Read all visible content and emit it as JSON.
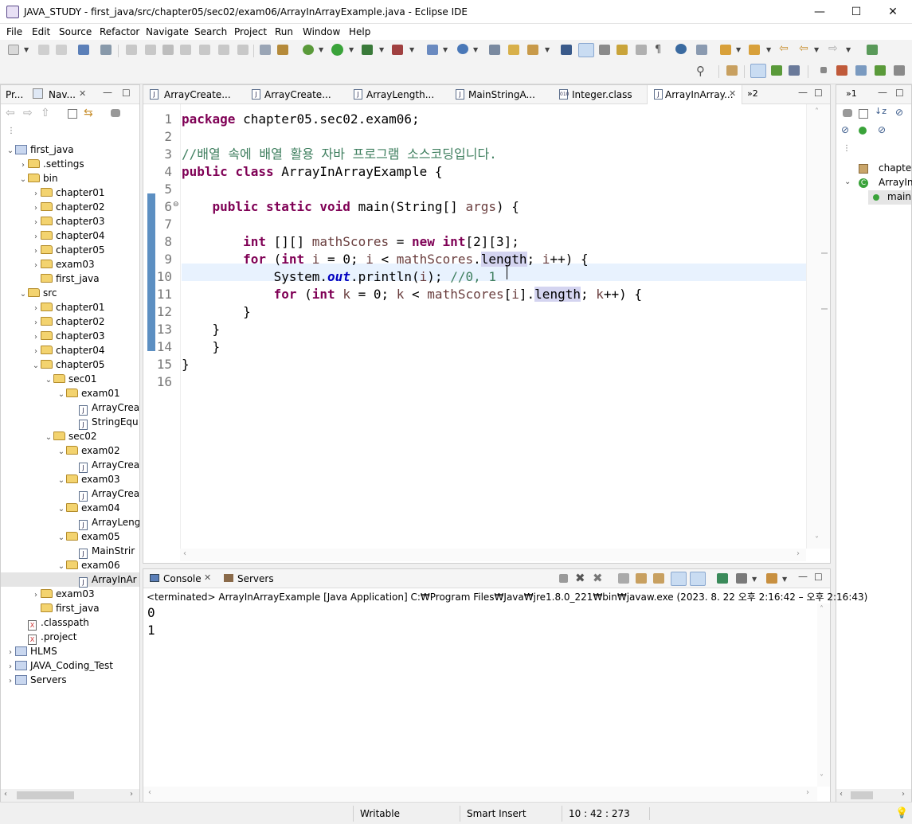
{
  "window": {
    "title": "JAVA_STUDY - first_java/src/chapter05/sec02/exam06/ArrayInArrayExample.java - Eclipse IDE",
    "minimize": "—",
    "maximize": "☐",
    "close": "✕"
  },
  "menu": [
    "File",
    "Edit",
    "Source",
    "Refactor",
    "Navigate",
    "Search",
    "Project",
    "Run",
    "Window",
    "Help"
  ],
  "left_panel": {
    "tabs": [
      "Pr...",
      "Nav..."
    ],
    "tree": [
      {
        "label": "first_java",
        "indent": 0,
        "arrow": "⌄",
        "icon": "project"
      },
      {
        "label": ".settings",
        "indent": 1,
        "arrow": "›",
        "icon": "folder"
      },
      {
        "label": "bin",
        "indent": 1,
        "arrow": "⌄",
        "icon": "folder"
      },
      {
        "label": "chapter01",
        "indent": 2,
        "arrow": "›",
        "icon": "folder"
      },
      {
        "label": "chapter02",
        "indent": 2,
        "arrow": "›",
        "icon": "folder"
      },
      {
        "label": "chapter03",
        "indent": 2,
        "arrow": "›",
        "icon": "folder"
      },
      {
        "label": "chapter04",
        "indent": 2,
        "arrow": "›",
        "icon": "folder"
      },
      {
        "label": "chapter05",
        "indent": 2,
        "arrow": "›",
        "icon": "folder"
      },
      {
        "label": "exam03",
        "indent": 2,
        "arrow": "›",
        "icon": "folder"
      },
      {
        "label": "first_java",
        "indent": 2,
        "arrow": "",
        "icon": "folder"
      },
      {
        "label": "src",
        "indent": 1,
        "arrow": "⌄",
        "icon": "folder"
      },
      {
        "label": "chapter01",
        "indent": 2,
        "arrow": "›",
        "icon": "folder"
      },
      {
        "label": "chapter02",
        "indent": 2,
        "arrow": "›",
        "icon": "folder"
      },
      {
        "label": "chapter03",
        "indent": 2,
        "arrow": "›",
        "icon": "folder"
      },
      {
        "label": "chapter04",
        "indent": 2,
        "arrow": "›",
        "icon": "folder"
      },
      {
        "label": "chapter05",
        "indent": 2,
        "arrow": "⌄",
        "icon": "folder"
      },
      {
        "label": "sec01",
        "indent": 3,
        "arrow": "⌄",
        "icon": "folder"
      },
      {
        "label": "exam01",
        "indent": 4,
        "arrow": "⌄",
        "icon": "folder"
      },
      {
        "label": "ArrayCrea",
        "indent": 5,
        "arrow": "",
        "icon": "java"
      },
      {
        "label": "StringEqu",
        "indent": 5,
        "arrow": "",
        "icon": "java"
      },
      {
        "label": "sec02",
        "indent": 3,
        "arrow": "⌄",
        "icon": "folder"
      },
      {
        "label": "exam02",
        "indent": 4,
        "arrow": "⌄",
        "icon": "folder"
      },
      {
        "label": "ArrayCrea",
        "indent": 5,
        "arrow": "",
        "icon": "java"
      },
      {
        "label": "exam03",
        "indent": 4,
        "arrow": "⌄",
        "icon": "folder"
      },
      {
        "label": "ArrayCrea",
        "indent": 5,
        "arrow": "",
        "icon": "java"
      },
      {
        "label": "exam04",
        "indent": 4,
        "arrow": "⌄",
        "icon": "folder"
      },
      {
        "label": "ArrayLeng",
        "indent": 5,
        "arrow": "",
        "icon": "java"
      },
      {
        "label": "exam05",
        "indent": 4,
        "arrow": "⌄",
        "icon": "folder"
      },
      {
        "label": "MainStrir",
        "indent": 5,
        "arrow": "",
        "icon": "java"
      },
      {
        "label": "exam06",
        "indent": 4,
        "arrow": "⌄",
        "icon": "folder"
      },
      {
        "label": "ArrayInAr",
        "indent": 5,
        "arrow": "",
        "icon": "java",
        "selected": true
      },
      {
        "label": "exam03",
        "indent": 2,
        "arrow": "›",
        "icon": "folder"
      },
      {
        "label": "first_java",
        "indent": 2,
        "arrow": "",
        "icon": "folder"
      },
      {
        "label": ".classpath",
        "indent": 1,
        "arrow": "",
        "icon": "xml"
      },
      {
        "label": ".project",
        "indent": 1,
        "arrow": "",
        "icon": "xml"
      },
      {
        "label": "HLMS",
        "indent": 0,
        "arrow": "›",
        "icon": "project"
      },
      {
        "label": "JAVA_Coding_Test",
        "indent": 0,
        "arrow": "›",
        "icon": "project"
      },
      {
        "label": "Servers",
        "indent": 0,
        "arrow": "›",
        "icon": "project"
      }
    ]
  },
  "editor": {
    "tabs": [
      "ArrayCreate...",
      "ArrayCreate...",
      "ArrayLength...",
      "MainStringA...",
      "Integer.class",
      "ArrayInArray..."
    ],
    "overflow": "»2",
    "lines": [
      {
        "n": "1",
        "html": "<span class='kw'>package</span> chapter05.sec02.exam06;"
      },
      {
        "n": "2",
        "html": ""
      },
      {
        "n": "3",
        "html": "<span class='cm'>//배열 속에 배열 활용 자바 프로그램 소스코딩입니다.</span>"
      },
      {
        "n": "4",
        "html": "<span class='kw'>public</span> <span class='kw'>class</span> ArrayInArrayExample {"
      },
      {
        "n": "5",
        "html": ""
      },
      {
        "n": "6",
        "html": "    <span class='kw'>public</span> <span class='kw'>static</span> <span class='kw'>void</span> main(String[] <span class='vr'>args</span>) {"
      },
      {
        "n": "7",
        "html": ""
      },
      {
        "n": "8",
        "html": "        <span class='kw'>int</span> [][] <span class='vr'>mathScores</span> = <span class='kw'>new</span> <span class='kw'>int</span>[2][3];"
      },
      {
        "n": "9",
        "html": "        <span class='kw'>for</span> (<span class='kw'>int</span> <span class='vr'>i</span> = 0; <span class='vr'>i</span> &lt; <span class='vr'>mathScores</span>.<span class='hl'>length</span>; <span class='vr'>i</span>++) {"
      },
      {
        "n": "10",
        "html": "            System.<span class='st'>out</span>.println(<span class='vr'>i</span>); <span class='cm'>//0, 1</span>"
      },
      {
        "n": "11",
        "html": "            <span class='kw'>for</span> (<span class='kw'>int</span> <span class='vr'>k</span> = 0; <span class='vr'>k</span> &lt; <span class='vr'>mathScores</span>[<span class='vr'>i</span>].<span class='hl'>length</span>; <span class='vr'>k</span>++) {"
      },
      {
        "n": "12",
        "html": "        }"
      },
      {
        "n": "13",
        "html": "    }"
      },
      {
        "n": "14",
        "html": "    }"
      },
      {
        "n": "15",
        "html": "}"
      },
      {
        "n": "16",
        "html": ""
      }
    ]
  },
  "right_panel": {
    "tab": "»1",
    "items": [
      "chapter",
      "ArrayIn",
      "main"
    ]
  },
  "console": {
    "tabs": [
      "Console",
      "Servers"
    ],
    "header": "<terminated> ArrayInArrayExample [Java Application] C:₩Program Files₩Java₩jre1.8.0_221₩bin₩javaw.exe  (2023. 8. 22 오후 2:16:42 – 오후 2:16:43)",
    "output": [
      "0",
      "1"
    ]
  },
  "status": {
    "writable": "Writable",
    "insert_mode": "Smart Insert",
    "position": "10 : 42 : 273"
  }
}
